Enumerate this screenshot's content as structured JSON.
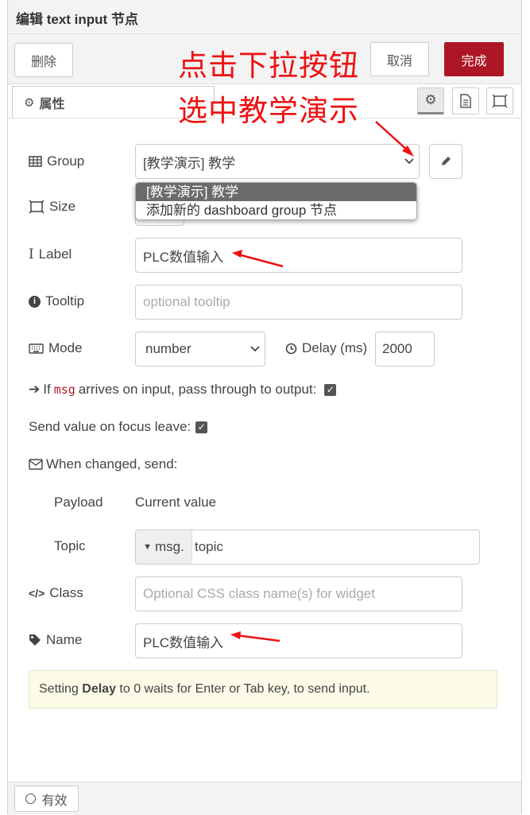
{
  "dialog": {
    "title": "编辑 text input 节点"
  },
  "toolbar": {
    "delete_label": "删除",
    "cancel_label": "取消",
    "done_label": "完成"
  },
  "tabs": {
    "properties_label": "属性"
  },
  "annotation": {
    "line1": "点击下拉按钮",
    "line2": "选中教学演示"
  },
  "form": {
    "group": {
      "label": "Group",
      "value": "[教学演示] 教学"
    },
    "group_options": [
      "[教学演示] 教学",
      "添加新的 dashboard group 节点"
    ],
    "size": {
      "label": "Size"
    },
    "label_field": {
      "label": "Label",
      "value": "PLC数值输入"
    },
    "tooltip": {
      "label": "Tooltip",
      "placeholder": "optional tooltip"
    },
    "mode": {
      "label": "Mode",
      "value": "number"
    },
    "delay": {
      "label": "Delay (ms)",
      "value": "2000"
    },
    "passthrough": {
      "prefix": "If",
      "code": "msg",
      "suffix": "arrives on input, pass through to output:"
    },
    "focus_leave": {
      "label": "Send value on focus leave:"
    },
    "when_changed": {
      "label": "When changed, send:"
    },
    "payload": {
      "label": "Payload",
      "value": "Current value"
    },
    "topic": {
      "label": "Topic",
      "prefix": "msg.",
      "value": "topic"
    },
    "class": {
      "label": "Class",
      "placeholder": "Optional CSS class name(s) for widget"
    },
    "name": {
      "label": "Name",
      "value": "PLC数值输入"
    }
  },
  "tip": {
    "before": "Setting",
    "bold": "Delay",
    "after": "to 0 waits for Enter or Tab key, to send input."
  },
  "footer": {
    "status_label": "有效"
  },
  "colors": {
    "accent": "#ad1625",
    "annotation": "#ee1111"
  }
}
